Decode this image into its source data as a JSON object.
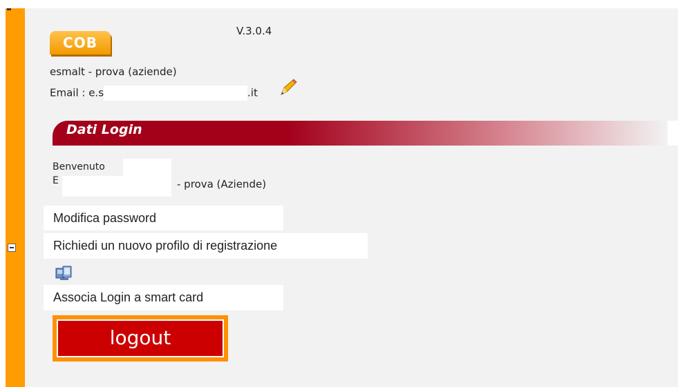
{
  "header": {
    "logo_text": "COB",
    "version": "V.3.0.4",
    "company": "esmalt - prova (aziende)",
    "email_prefix": "Email : e.s",
    "email_suffix": ".it",
    "edit_icon": "pencil-icon"
  },
  "section": {
    "title": "Dati Login"
  },
  "welcome": {
    "line1": "Benvenuto",
    "line2_prefix": "E",
    "line2_suffix": "- prova (Aziende)"
  },
  "actions": {
    "change_password": "Modifica password",
    "new_profile": "Richiedi un nuovo profilo di registrazione",
    "smartcard_icon": "computer-icon",
    "smartcard": "Associa Login a smart card",
    "logout": "logout"
  },
  "colors": {
    "sidebar": "#ff9c00",
    "section_bar": "#a3001a",
    "logout_bg": "#cc0000",
    "logout_border": "#ff9000"
  }
}
